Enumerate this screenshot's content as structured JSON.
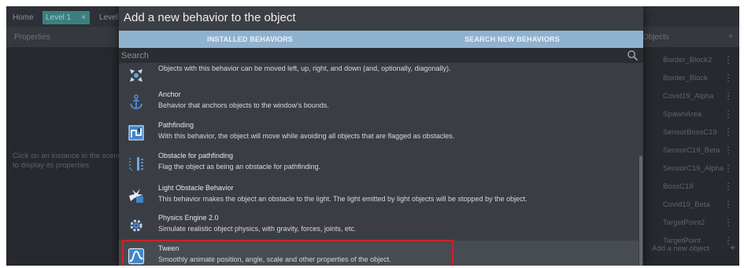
{
  "background": {
    "tabs": [
      "Home",
      "Level 1",
      "Level"
    ],
    "tab_close": "×",
    "properties_title": "Properties",
    "properties_hint": "Click on an instance in the scene to display its properties",
    "objects_title": "Objects",
    "objects_close": "×",
    "objects": [
      "Border_Block2",
      "Border_Block",
      "Covid19_Alpha",
      "SpawnArea",
      "SensorBossC19",
      "SensorC19_Beta",
      "SensorC19_Alpha",
      "BossC19",
      "Covid19_Beta",
      "TargetPoint2",
      "TargetPoint"
    ],
    "add_object": "Add a new object",
    "add_object_icon": "+",
    "kebab": "⋮"
  },
  "dialog": {
    "title": "Add a new behavior to the object",
    "tabs": [
      "INSTALLED BEHAVIORS",
      "SEARCH NEW BEHAVIORS"
    ],
    "search_placeholder": "Search",
    "behaviors": [
      {
        "name": "",
        "description": "Objects with this behavior can be moved left, up, right, and down (and, optionally, diagonally).",
        "icon": "arrows-move-icon"
      },
      {
        "name": "Anchor",
        "description": "Behavior that anchors objects to the window's bounds.",
        "icon": "anchor-icon"
      },
      {
        "name": "Pathfinding",
        "description": "With this behavior, the object will move while avoiding all objects that are flagged as obstacles.",
        "icon": "pathfinding-icon"
      },
      {
        "name": "Obstacle for pathfinding",
        "description": "Flag the object as being an obstacle for pathfinding.",
        "icon": "obstacle-icon"
      },
      {
        "name": "Light Obstacle Behavior",
        "description": "This behavior makes the object an obstacle to the light. The light emitted by light objects will be stopped by the object.",
        "icon": "light-obstacle-icon"
      },
      {
        "name": "Physics Engine 2.0",
        "description": "Simulate realistic object physics, with gravity, forces, joints, etc.",
        "icon": "physics-gear-icon"
      },
      {
        "name": "Tween",
        "description": "Smoothly animate position, angle, scale and other properties of the object.",
        "icon": "tween-curve-icon"
      }
    ]
  },
  "colors": {
    "selected_outline": "#c8242a",
    "tab_bar": "#8fb2cf",
    "dialog_bg": "#3c4046"
  }
}
